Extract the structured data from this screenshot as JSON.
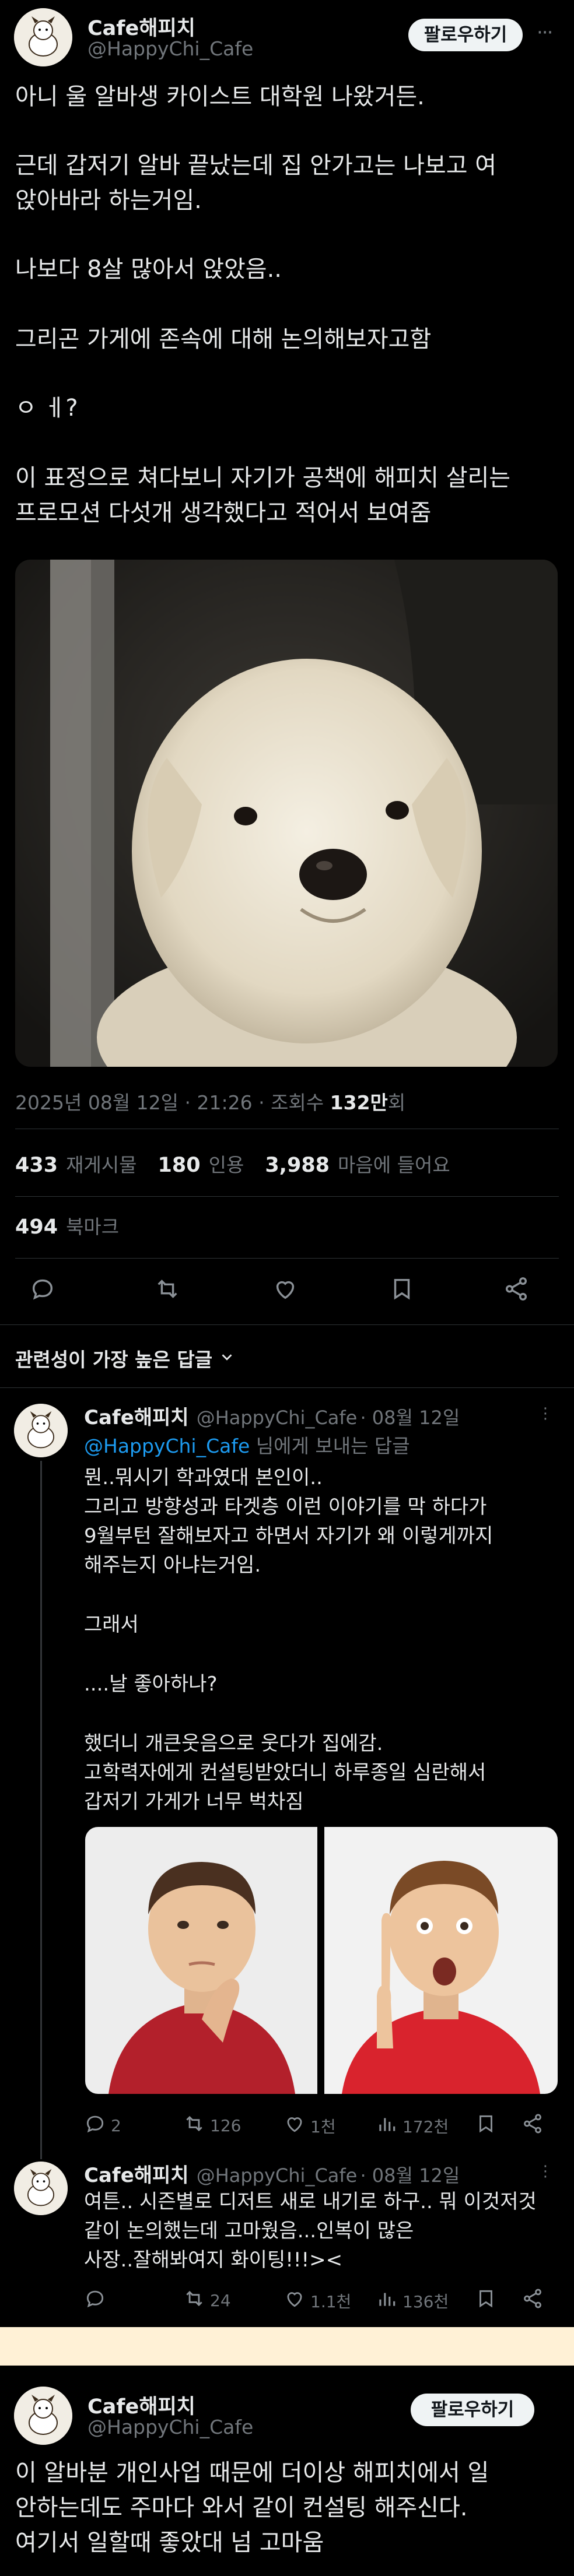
{
  "post1": {
    "name": "Cafe해피치",
    "handle": "@HappyChi_Cafe",
    "follow_label": "팔로우하기",
    "lines": [
      "아니 울 알바생 카이스트 대학원 나왔거든.",
      "근데 갑저기 알바 끝났는데 집 안가고는 나보고 여",
      "앉아바라 하는거임.",
      "나보다 8살 많아서 앉았음..",
      "그리곤 가게에 존속에 대해 논의해보자고함",
      "ㅇ ㅔ?",
      "이 표정으로 쳐다보니 자기가 공책에 해피치 살리는",
      "프로모션 다섯개 생각했다고 적어서 보여줌"
    ],
    "timestamp": "2025년 08월 12일 · 21:26 · 조회수",
    "views": "132만",
    "views_unit": "회",
    "stats": {
      "reposts_num": "433",
      "reposts_label": "재게시물",
      "quotes_num": "180",
      "quotes_label": "인용",
      "likes_num": "3,988",
      "likes_label": "마음에 들어요",
      "bookmarks_num": "494",
      "bookmarks_label": "북마크"
    }
  },
  "sort": {
    "label": "관련성이 가장 높은 답글"
  },
  "reply1": {
    "name": "Cafe해피치",
    "handle": "@HappyChi_Cafe",
    "date": "· 08월 12일",
    "replying_handle": "@HappyChi_Cafe",
    "replying_suffix": "님에게 보내는 답글",
    "lines": [
      "뭔..뭐시기 학과였대 본인이..",
      "그리고 방향성과 타겟층 이런 이야기를 막 하다가",
      "9월부턴 잘해보자고 하면서 자기가 왜 이렇게까지",
      "해주는지 아냐는거임.",
      "그래서",
      "....날 좋아하나?",
      "했더니 개큰웃음으로 웃다가 집에감.",
      "고학력자에게 컨설팅받았더니 하루종일 심란해서",
      "갑저기 가게가 너무 벅차짐"
    ],
    "actions": {
      "replies": "2",
      "reposts": "126",
      "likes": "1천",
      "views": "172천"
    }
  },
  "reply2": {
    "name": "Cafe해피치",
    "handle": "@HappyChi_Cafe",
    "date": "· 08월 12일",
    "lines": [
      "여튼.. 시즌별로 디저트 새로 내기로 하구.. 뭐 이것저것",
      "같이 논의했는데 고마웠음...인복이 많은",
      "사장..잘해봐여지 화이팅!!!>< "
    ],
    "actions": {
      "replies": "",
      "reposts": "24",
      "likes": "1.1천",
      "views": "136천"
    }
  },
  "post2": {
    "name": "Cafe해피치",
    "handle": "@HappyChi_Cafe",
    "follow_label": "팔로우하기",
    "lines": [
      "이 알바분 개인사업 때문에 더이상 해피치에서 일",
      "안하는데도 주마다 와서 같이 컨설팅 해주신다.",
      "여기서 일할때 좋았대 넘 고마움"
    ]
  },
  "colors": {
    "accent": "#1d9bf0",
    "divider": "#2f3336",
    "muted": "#71767b",
    "separator": "#fff1d6"
  },
  "icons": [
    "reply-icon",
    "repost-icon",
    "like-icon",
    "bookmark-icon",
    "share-icon",
    "views-icon",
    "more-icon",
    "chevron-down-icon"
  ]
}
